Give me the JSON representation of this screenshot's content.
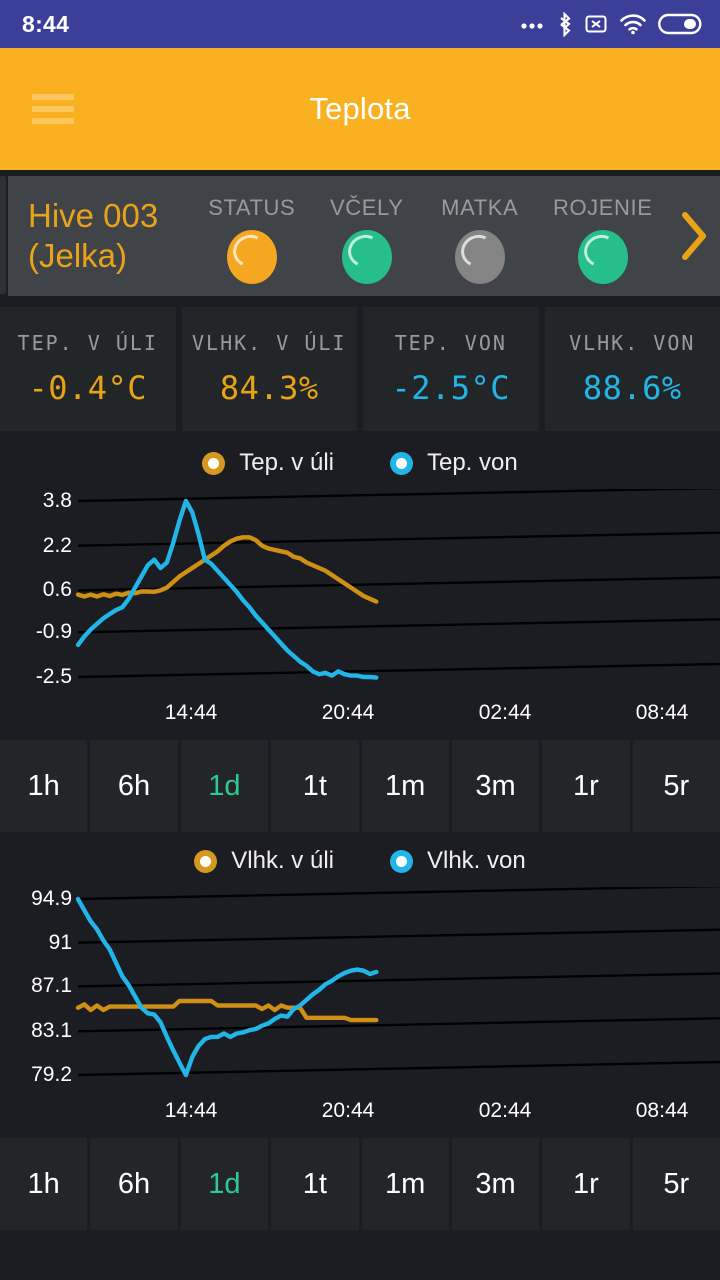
{
  "status_bar": {
    "time": "8:44",
    "icons": [
      "more-dots-icon",
      "bluetooth-icon",
      "no-sim-icon",
      "wifi-icon",
      "battery-icon"
    ]
  },
  "app_bar": {
    "title": "Teplota",
    "menu_icon": "hamburger-menu-icon"
  },
  "hive": {
    "name_line1": "Hive 003",
    "name_line2": "(Jelka)",
    "next_icon": "chevron-right-icon",
    "statuses": [
      {
        "label": "STATUS",
        "color": "#f5a722",
        "state": "orange"
      },
      {
        "label": "VČELY",
        "color": "#26bf8c",
        "state": "green"
      },
      {
        "label": "MATKA",
        "color": "#848484",
        "state": "gray"
      },
      {
        "label": "ROJENIE",
        "color": "#26bf8c",
        "state": "green"
      }
    ]
  },
  "metrics": [
    {
      "label": "TEP. V ÚLI",
      "value": "-0.4°C",
      "color": "#e8a317"
    },
    {
      "label": "VLHK. V ÚLI",
      "value": "84.3%",
      "color": "#e8a317"
    },
    {
      "label": "TEP. VON",
      "value": "-2.5°C",
      "color": "#22b5e8"
    },
    {
      "label": "VLHK. VON",
      "value": "88.6%",
      "color": "#22b5e8"
    }
  ],
  "ranges": {
    "options": [
      "1h",
      "6h",
      "1d",
      "1t",
      "1m",
      "3m",
      "1r",
      "5r"
    ],
    "selected": "1d"
  },
  "chart_data": [
    {
      "id": "temperature",
      "type": "line",
      "title": "",
      "xlabel": "",
      "ylabel": "",
      "grid": true,
      "legend_position": "top-center",
      "y_ticks": [
        3.8,
        2.2,
        0.6,
        -0.9,
        -2.5
      ],
      "y_tick_labels": [
        "3.8",
        "2.2",
        "0.6",
        "-0.9",
        "-2.5"
      ],
      "ylim": [
        -2.5,
        3.8
      ],
      "x_ticks": [
        "14:44",
        "20:44",
        "02:44",
        "08:44"
      ],
      "xlim": [
        "11:44",
        "11:44+1d"
      ],
      "series": [
        {
          "name": "Tep. v úli",
          "color": "#cf9015",
          "x": [
            0,
            1,
            2,
            3,
            4,
            5,
            6,
            7,
            8,
            9,
            10,
            11,
            12,
            13,
            14,
            15,
            16,
            17,
            18,
            19,
            20,
            21,
            22,
            23,
            24,
            25,
            26,
            27,
            28,
            29,
            30,
            31,
            32,
            33,
            34,
            35,
            36,
            37,
            38,
            39,
            40,
            41,
            42,
            43,
            44,
            45,
            46,
            47
          ],
          "values": [
            0.45,
            0.38,
            0.45,
            0.38,
            0.46,
            0.4,
            0.48,
            0.44,
            0.52,
            0.5,
            0.56,
            0.56,
            0.55,
            0.6,
            0.7,
            0.9,
            1.1,
            1.25,
            1.4,
            1.55,
            1.7,
            1.85,
            2.0,
            2.2,
            2.35,
            2.45,
            2.5,
            2.5,
            2.4,
            2.2,
            2.1,
            2.05,
            2.0,
            1.95,
            1.8,
            1.75,
            1.6,
            1.5,
            1.4,
            1.3,
            1.15,
            1.0,
            0.85,
            0.7,
            0.55,
            0.4,
            0.3,
            0.2
          ]
        },
        {
          "name": "Tep. von",
          "color": "#22b5e8",
          "x": [
            0,
            1,
            2,
            3,
            4,
            5,
            6,
            7,
            8,
            9,
            10,
            11,
            12,
            13,
            14,
            15,
            16,
            17,
            18,
            19,
            20,
            21,
            22,
            23,
            24,
            25,
            26,
            27,
            28,
            29,
            30,
            31,
            32,
            33,
            34,
            35,
            36,
            37,
            38,
            39,
            40,
            41,
            42,
            43,
            44,
            45,
            46,
            47
          ],
          "values": [
            -1.35,
            -1.05,
            -0.8,
            -0.6,
            -0.4,
            -0.25,
            -0.1,
            0.0,
            0.3,
            0.7,
            1.1,
            1.5,
            1.7,
            1.4,
            1.6,
            2.3,
            3.1,
            3.8,
            3.4,
            2.6,
            1.7,
            1.55,
            1.3,
            1.05,
            0.8,
            0.55,
            0.25,
            0.0,
            -0.3,
            -0.55,
            -0.8,
            -1.05,
            -1.3,
            -1.55,
            -1.75,
            -1.95,
            -2.1,
            -2.3,
            -2.4,
            -2.35,
            -2.45,
            -2.3,
            -2.4,
            -2.45,
            -2.45,
            -2.5,
            -2.5,
            -2.52
          ]
        }
      ]
    },
    {
      "id": "humidity",
      "type": "line",
      "title": "",
      "xlabel": "",
      "ylabel": "",
      "grid": true,
      "legend_position": "top-center",
      "y_ticks": [
        94.9,
        91,
        87.1,
        83.1,
        79.2
      ],
      "y_tick_labels": [
        "94.9",
        "91",
        "87.1",
        "83.1",
        "79.2"
      ],
      "ylim": [
        79.2,
        94.9
      ],
      "x_ticks": [
        "14:44",
        "20:44",
        "02:44",
        "08:44"
      ],
      "xlim": [
        "11:44",
        "11:44+1d"
      ],
      "series": [
        {
          "name": "Vlhk. v úli",
          "color": "#cf9015",
          "x": [
            0,
            1,
            2,
            3,
            4,
            5,
            6,
            7,
            8,
            9,
            10,
            11,
            12,
            13,
            14,
            15,
            16,
            17,
            18,
            19,
            20,
            21,
            22,
            23,
            24,
            25,
            26,
            27,
            28,
            29,
            30,
            31,
            32,
            33,
            34,
            35,
            36,
            37,
            38,
            39,
            40,
            41,
            42,
            43,
            44,
            45,
            46,
            47
          ],
          "values": [
            85.2,
            85.5,
            85.0,
            85.4,
            85.0,
            85.3,
            85.3,
            85.3,
            85.3,
            85.3,
            85.3,
            85.3,
            85.3,
            85.3,
            85.3,
            85.3,
            85.8,
            85.8,
            85.8,
            85.8,
            85.8,
            85.8,
            85.4,
            85.4,
            85.4,
            85.4,
            85.4,
            85.4,
            85.4,
            85.1,
            85.4,
            85.0,
            85.4,
            85.2,
            85.2,
            85.2,
            84.3,
            84.3,
            84.3,
            84.3,
            84.3,
            84.3,
            84.3,
            84.1,
            84.1,
            84.1,
            84.1,
            84.1
          ]
        },
        {
          "name": "Vlhk. von",
          "color": "#22b5e8",
          "x": [
            0,
            1,
            2,
            3,
            4,
            5,
            6,
            7,
            8,
            9,
            10,
            11,
            12,
            13,
            14,
            15,
            16,
            17,
            18,
            19,
            20,
            21,
            22,
            23,
            24,
            25,
            26,
            27,
            28,
            29,
            30,
            31,
            32,
            33,
            34,
            35,
            36,
            37,
            38,
            39,
            40,
            41,
            42,
            43,
            44,
            45,
            46,
            47
          ],
          "values": [
            94.9,
            93.9,
            92.9,
            92.2,
            91.2,
            90.4,
            89.2,
            88.0,
            87.2,
            86.2,
            85.2,
            84.7,
            84.6,
            83.9,
            82.6,
            81.4,
            80.3,
            79.2,
            80.8,
            81.8,
            82.4,
            82.6,
            82.6,
            82.9,
            82.6,
            82.9,
            83.0,
            83.2,
            83.3,
            83.6,
            83.8,
            84.2,
            84.5,
            84.4,
            85.1,
            85.4,
            85.9,
            86.4,
            86.8,
            87.3,
            87.6,
            88.0,
            88.3,
            88.5,
            88.6,
            88.5,
            88.2,
            88.4
          ]
        }
      ]
    }
  ]
}
